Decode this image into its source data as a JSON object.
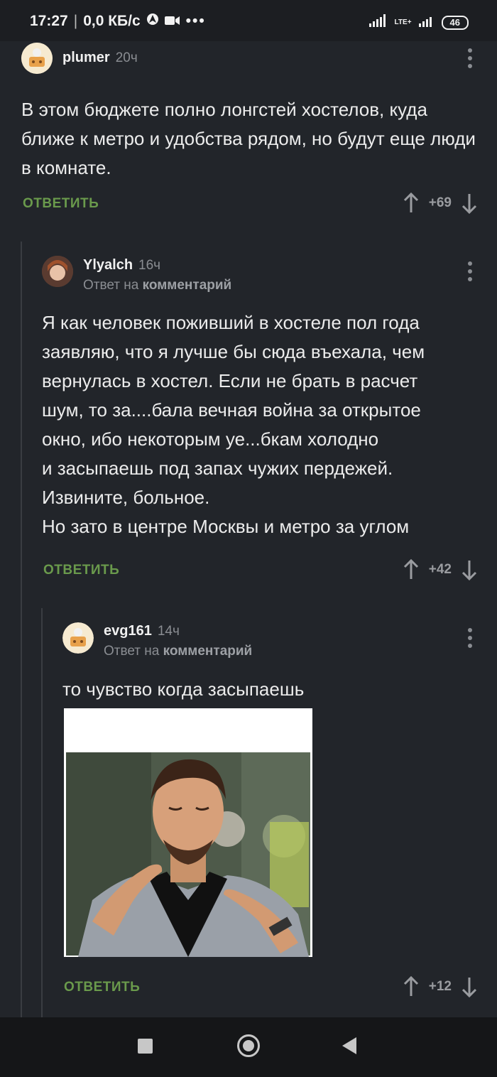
{
  "status": {
    "time": "17:27",
    "speed": "0,0 КБ/с",
    "network": "LTE+",
    "battery": "46"
  },
  "comments": [
    {
      "user": "plumer",
      "time": "20ч",
      "reply_to": null,
      "text": "В этом бюджете полно лонгстей хостелов, куда ближе к метро и удобства рядом, но будут еще люди в комнате.",
      "reply_label": "ОТВЕТИТЬ",
      "score": "+69"
    },
    {
      "user": "Ylyalch",
      "time": "16ч",
      "reply_to_prefix": "Ответ на",
      "reply_to_target": "комментарий",
      "text_lines": [
        "Я как человек поживший в хостеле пол года",
        "заявляю, что я лучше бы сюда въехала, чем",
        "вернулась в хостел. Если не брать в расчет",
        "шум, то за....бала вечная война за открытое",
        "окно, ибо некоторым уе...бкам холодно",
        "и засыпаешь под запах чужих пердежей.",
        "Извините, больное.",
        "Но зато в центре Москвы и метро за углом"
      ],
      "reply_label": "ОТВЕТИТЬ",
      "score": "+42"
    },
    {
      "user": "evg161",
      "time": "14ч",
      "reply_to_prefix": "Ответ на",
      "reply_to_target": "комментарий",
      "text": "то чувство когда засыпаешь",
      "reply_label": "ОТВЕТИТЬ",
      "score": "+12"
    }
  ],
  "colors": {
    "background": "#22252a",
    "reply_button": "#6a9a4c",
    "muted": "#8a8d92"
  }
}
